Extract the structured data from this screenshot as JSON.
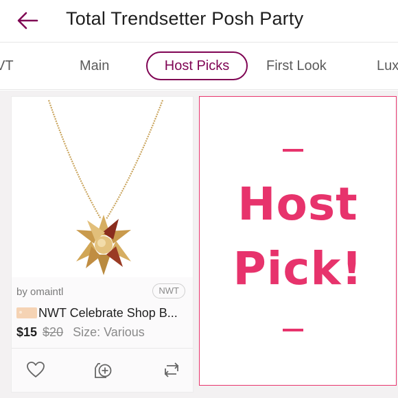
{
  "header": {
    "title": "Total Trendsetter Posh Party"
  },
  "tabs": [
    {
      "label": "VT"
    },
    {
      "label": "Main"
    },
    {
      "label": "Host Picks"
    },
    {
      "label": "First Look"
    },
    {
      "label": "Lux"
    }
  ],
  "listing": {
    "seller": "by omaintl",
    "badge": "NWT",
    "title": "NWT Celebrate Shop B...",
    "price": "$15",
    "original_price": "$20",
    "size": "Size: Various",
    "image_icon": "gold-bow-necklace"
  },
  "host_pick": {
    "line1": "Host",
    "line2": "Pick!",
    "color": "#e7336c"
  },
  "colors": {
    "brand": "#7f0353",
    "accent": "#e7336c"
  },
  "icons": {
    "back": "back-arrow-icon",
    "like": "heart-icon",
    "bundle": "bundle-add-icon",
    "share": "share-icon"
  }
}
